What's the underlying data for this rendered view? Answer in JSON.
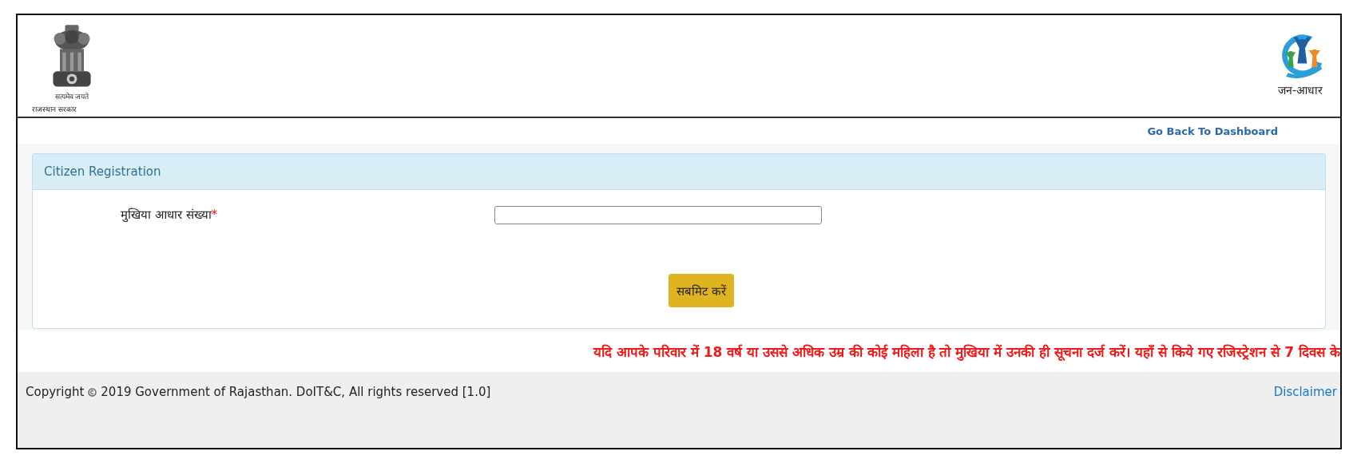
{
  "header": {
    "emblem_motto": "सत्यमेव जयते",
    "state_caption": "राजस्थान सरकार",
    "logo_caption": "जन-आधार"
  },
  "nav": {
    "link": "Go Back To Dashboard"
  },
  "panel": {
    "title": "Citizen Registration",
    "field": {
      "label": "मुखिया आधार संख्या",
      "required_mark": "*"
    },
    "submit": "सबमिट करें"
  },
  "notice": "यदि आपके परिवार में 18 वर्ष या उससे अधिक उम्र की कोई महिला है तो मुखिया में उनकी ही सूचना दर्ज करें। यहाँ से किये गए रजिस्ट्रेशन से 7 दिवस के",
  "footer": {
    "copyright_before": "Copyright",
    "copyright_after": "2019 Government of Rajasthan. DoIT&C, All rights reserved [1.0]",
    "link": "Disclaimer"
  }
}
